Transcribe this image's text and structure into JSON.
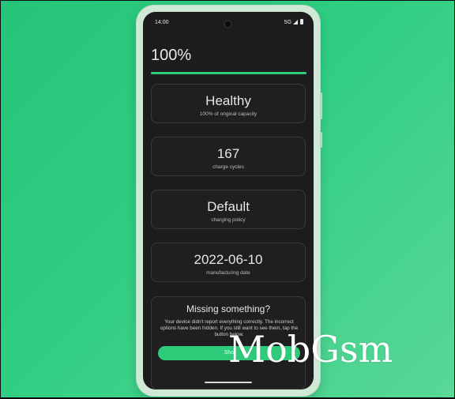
{
  "status_bar": {
    "time": "14:00",
    "network": "5G"
  },
  "battery_percent": {
    "label": "100%",
    "fill_fraction": 1.0
  },
  "cards": [
    {
      "value": "Healthy",
      "label": "100% of original capacity"
    },
    {
      "value": "167",
      "label": "charge cycles"
    },
    {
      "value": "Default",
      "label": "charging policy"
    },
    {
      "value": "2022-06-10",
      "label": "manufacturing date"
    }
  ],
  "missing": {
    "title": "Missing something?",
    "body": "Your device didn't report everything correctly.  The incorrect options have been hidden. If you still want to see them, tap the button below.",
    "button_label": "Sho"
  },
  "watermark": "MobGsm",
  "colors": {
    "accent": "#2ecc7a",
    "screen_bg": "#1c1c1e",
    "page_bg": "#2fce82"
  }
}
